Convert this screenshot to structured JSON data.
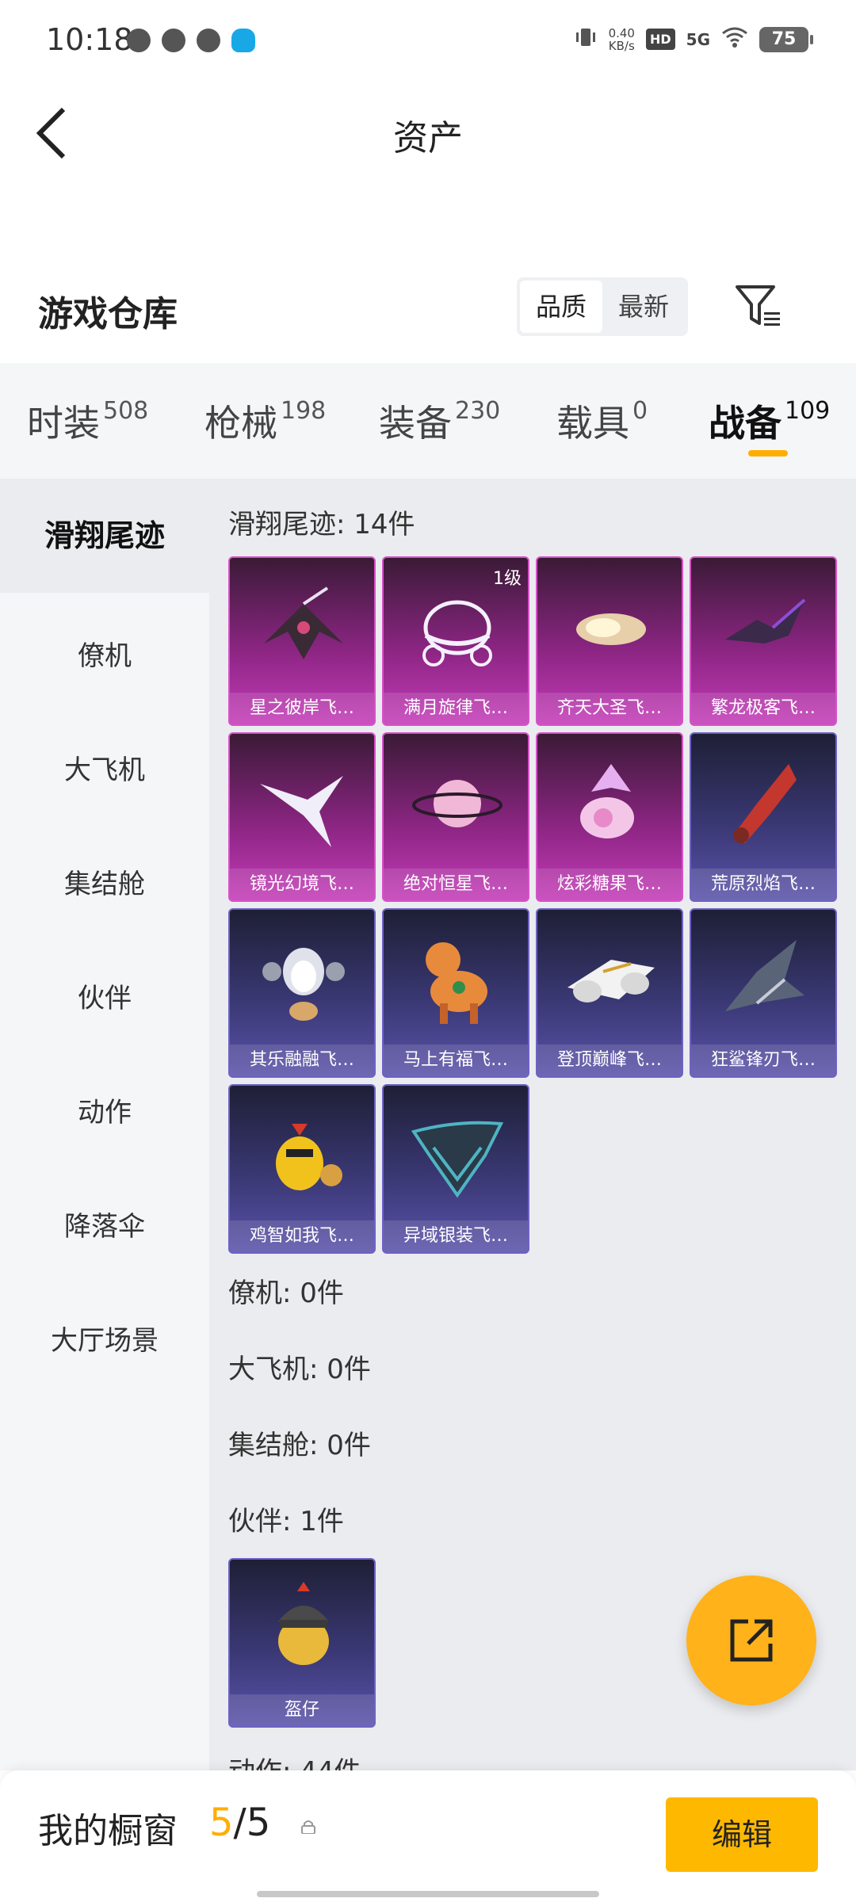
{
  "status_bar": {
    "time": "10:18",
    "net_speed_value": "0.40",
    "net_speed_unit": "KB/s",
    "hd": "HD",
    "signal": "5G",
    "battery": "75"
  },
  "header": {
    "title": "资产"
  },
  "warehouse": {
    "title": "游戏仓库",
    "sort_options": [
      "品质",
      "最新"
    ]
  },
  "tabs": [
    {
      "label": "时装",
      "count": "508"
    },
    {
      "label": "枪械",
      "count": "198"
    },
    {
      "label": "装备",
      "count": "230"
    },
    {
      "label": "载具",
      "count": "0"
    },
    {
      "label": "战备",
      "count": "109"
    }
  ],
  "sidebar": [
    "滑翔尾迹",
    "僚机",
    "大飞机",
    "集结舱",
    "伙伴",
    "动作",
    "降落伞",
    "大厅场景"
  ],
  "sections": {
    "glide_trail": "滑翔尾迹: 14件",
    "wingman": "僚机: 0件",
    "big_plane": "大飞机: 0件",
    "assembly": "集结舱: 0件",
    "partner": "伙伴: 1件",
    "action": "动作: 44件"
  },
  "items": [
    {
      "name": "星之彼岸飞…",
      "icon": "star-shore-glider-icon",
      "color": "#e8e2f2"
    },
    {
      "name": "满月旋律飞…",
      "icon": "moon-carriage-icon",
      "level": "1级",
      "color": "#f4f0ff"
    },
    {
      "name": "齐天大圣飞…",
      "icon": "golden-cloud-icon",
      "color": "#f3e2b0"
    },
    {
      "name": "繁龙极客飞…",
      "icon": "dragon-wing-icon",
      "color": "#8a4fd6"
    },
    {
      "name": "镜光幻境飞…",
      "icon": "crystal-wing-icon",
      "color": "#f0eef8"
    },
    {
      "name": "绝对恒星飞…",
      "icon": "planet-icon",
      "color": "#f0b7d6"
    },
    {
      "name": "炫彩糖果飞…",
      "icon": "candy-icon",
      "color": "#f3c6e8"
    },
    {
      "name": "荒原烈焰飞…",
      "icon": "flame-blade-icon",
      "color": "#c4372e"
    },
    {
      "name": "其乐融融飞…",
      "icon": "penguin-icon",
      "color": "#dfe2ea"
    },
    {
      "name": "马上有福飞…",
      "icon": "horse-icon",
      "color": "#e88a3c"
    },
    {
      "name": "登顶巅峰飞…",
      "icon": "jet-icon",
      "color": "#f2f2f2"
    },
    {
      "name": "狂鲨锋刃飞…",
      "icon": "shark-icon",
      "color": "#5a6478"
    },
    {
      "name": "鸡智如我飞…",
      "icon": "chick-icon",
      "color": "#f2c21c"
    },
    {
      "name": "异域银装飞…",
      "icon": "alien-wing-icon",
      "color": "#4fb4c4"
    }
  ],
  "partner_items": [
    {
      "name": "盔仔",
      "icon": "helmet-chick-icon",
      "color": "#e8b93a"
    }
  ],
  "bottom_bar": {
    "title": "我的橱窗",
    "current": "5",
    "total": "/5",
    "edit_label": "编辑"
  },
  "colors": {
    "accent": "#ffae00",
    "pink_card": "#8b2582",
    "blue_card": "#3a3874"
  }
}
